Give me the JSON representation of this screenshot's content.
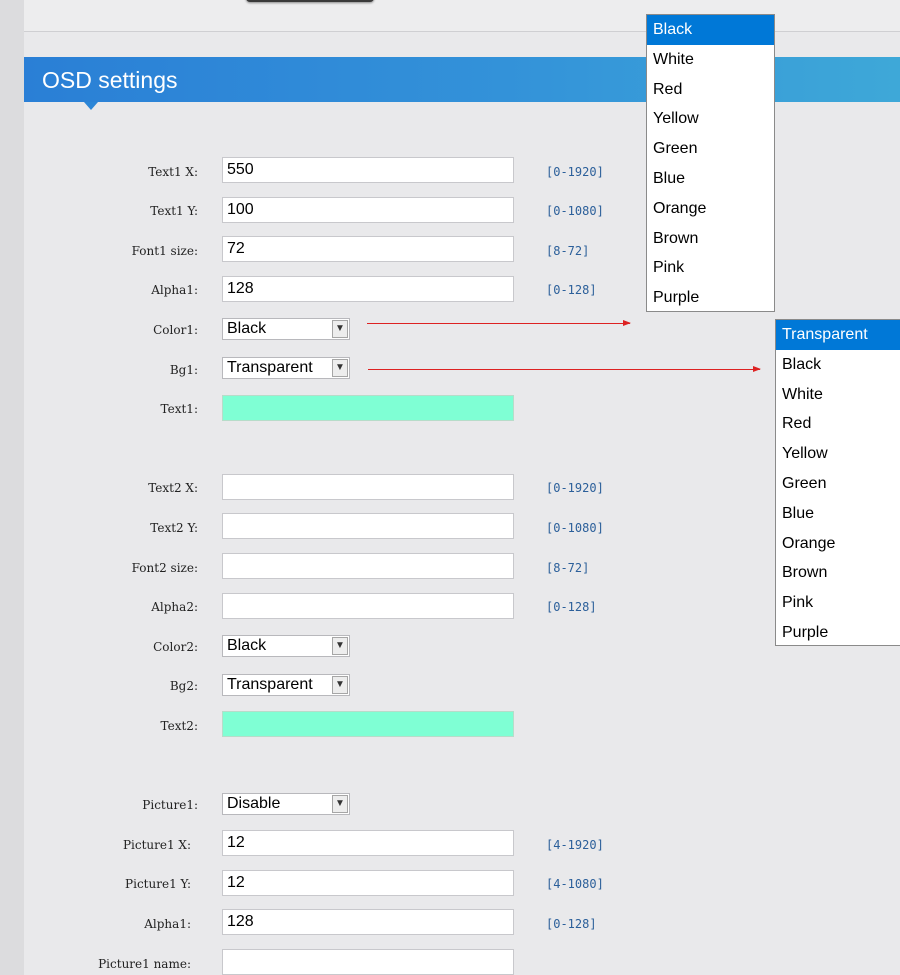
{
  "header": {
    "title": "OSD settings"
  },
  "text1": {
    "x_label": "Text1 X:",
    "x_value": "550",
    "x_range": "[0-1920]",
    "y_label": "Text1 Y:",
    "y_value": "100",
    "y_range": "[0-1080]",
    "font_label": "Font1 size:",
    "font_value": "72",
    "font_range": "[8-72]",
    "alpha_label": "Alpha1:",
    "alpha_value": "128",
    "alpha_range": "[0-128]",
    "color_label": "Color1:",
    "color_value": "Black",
    "bg_label": "Bg1:",
    "bg_value": "Transparent",
    "text_label": "Text1:",
    "text_value": ""
  },
  "text2": {
    "x_label": "Text2 X:",
    "x_value": "",
    "x_range": "[0-1920]",
    "y_label": "Text2 Y:",
    "y_value": "",
    "y_range": "[0-1080]",
    "font_label": "Font2 size:",
    "font_value": "",
    "font_range": "[8-72]",
    "alpha_label": "Alpha2:",
    "alpha_value": "",
    "alpha_range": "[0-128]",
    "color_label": "Color2:",
    "color_value": "Black",
    "bg_label": "Bg2:",
    "bg_value": "Transparent",
    "text_label": "Text2:",
    "text_value": ""
  },
  "picture1": {
    "enable_label": "Picture1:",
    "enable_value": "Disable",
    "x_label": "Picture1 X:",
    "x_value": "12",
    "x_range": "[4-1920]",
    "y_label": "Picture1 Y:",
    "y_value": "12",
    "y_range": "[4-1080]",
    "alpha_label": "Alpha1:",
    "alpha_value": "128",
    "alpha_range": "[0-128]",
    "name_label": "Picture1 name:",
    "name_value": ""
  },
  "color_dropdown": {
    "options": [
      "Black",
      "White",
      "Red",
      "Yellow",
      "Green",
      "Blue",
      "Orange",
      "Brown",
      "Pink",
      "Purple"
    ],
    "selected": "Black"
  },
  "bg_dropdown": {
    "options": [
      "Transparent",
      "Black",
      "White",
      "Red",
      "Yellow",
      "Green",
      "Blue",
      "Orange",
      "Brown",
      "Pink",
      "Purple"
    ],
    "selected": "Transparent"
  },
  "colors": {
    "header_start": "#2a7fd6",
    "header_end": "#3ea8d8",
    "preview_bg": "#7fffd4",
    "annotation_arrow": "#dd2222",
    "selected_option": "#0078d7"
  }
}
